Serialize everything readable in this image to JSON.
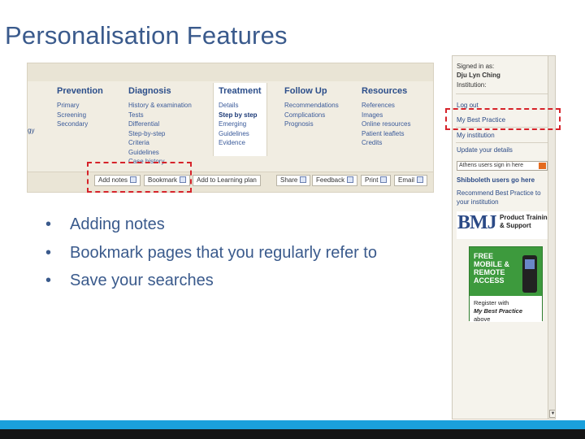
{
  "slide": {
    "title": "Personalisation Features"
  },
  "nav_screenshot": {
    "left_edge_fragment": "gy",
    "columns": [
      {
        "header": "Prevention",
        "items": [
          "Primary",
          "Screening",
          "Secondary"
        ]
      },
      {
        "header": "Diagnosis",
        "items": [
          "History & examination",
          "Tests",
          "Differential",
          "Step-by-step",
          "Criteria",
          "Guidelines",
          "Case history"
        ]
      },
      {
        "header": "Treatment",
        "items": [
          "Details",
          "Step by step",
          "Emerging",
          "Guidelines",
          "Evidence"
        ]
      },
      {
        "header": "Follow Up",
        "items": [
          "Recommendations",
          "Complications",
          "Prognosis"
        ]
      },
      {
        "header": "Resources",
        "items": [
          "References",
          "Images",
          "Online resources",
          "Patient leaflets",
          "Credits"
        ]
      }
    ],
    "tools": [
      {
        "label": "Add notes",
        "icon": "note-icon"
      },
      {
        "label": "Bookmark",
        "icon": "bookmark-icon"
      },
      {
        "label": "Add to Learning plan",
        "icon": ""
      },
      {
        "label": "Share",
        "icon": "share-icon"
      },
      {
        "label": "Feedback",
        "icon": "feedback-icon"
      },
      {
        "label": "Print",
        "icon": "print-icon"
      },
      {
        "label": "Email",
        "icon": "email-icon"
      }
    ]
  },
  "side_panel": {
    "signed_in_label": "Signed in as:",
    "user_name": "Dju Lyn Ching",
    "institution_label": "Institution:",
    "logout": "Log out",
    "my_best_practice": "My Best Practice",
    "my_institution": "My institution",
    "update_details": "Update your details",
    "select_value": "Athens users sign in here",
    "shibboleth": "Shibboleth users go here",
    "recommend_line1": "Recommend Best Practice to",
    "recommend_line2": "your institution",
    "bmj_logo": "BMJ",
    "bmj_tagline_1": "Product Training",
    "bmj_tagline_2": "& Support",
    "promo_lines": [
      "FREE",
      "MOBILE &",
      "REMOTE",
      "ACCESS"
    ],
    "promo_register": "Register with",
    "promo_my_bp": "My Best Practice",
    "promo_above": "above"
  },
  "bullets": [
    "Adding notes",
    "Bookmark pages that you regularly refer to",
    "Save your searches"
  ],
  "colors": {
    "title": "#3a5a8c",
    "highlight_dash": "#d6232a",
    "footer_blue": "#1aa0dc",
    "footer_dark": "#151515",
    "promo_green": "#3d9a3d"
  }
}
